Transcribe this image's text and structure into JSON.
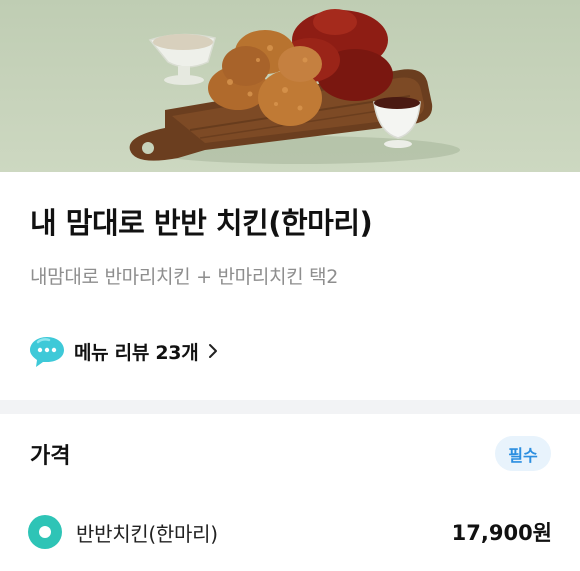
{
  "hero": {
    "image_name": "chicken-menu-photo"
  },
  "menu": {
    "title": "내 맘대로 반반 치킨(한마리)",
    "description": "내맘대로 반마리치킨 + 반마리치킨 택2"
  },
  "review": {
    "icon": "speech-bubble-icon",
    "label": "메뉴 리뷰 23개"
  },
  "price_section": {
    "title": "가격",
    "badge": "필수",
    "options": [
      {
        "name": "반반치킨(한마리)",
        "price": "17,900원",
        "selected": true
      }
    ]
  },
  "colors": {
    "accent_teal": "#2ec4b6",
    "badge_bg": "#e8f3fc",
    "badge_text": "#2b8ee0",
    "review_icon": "#3ec9d8"
  }
}
